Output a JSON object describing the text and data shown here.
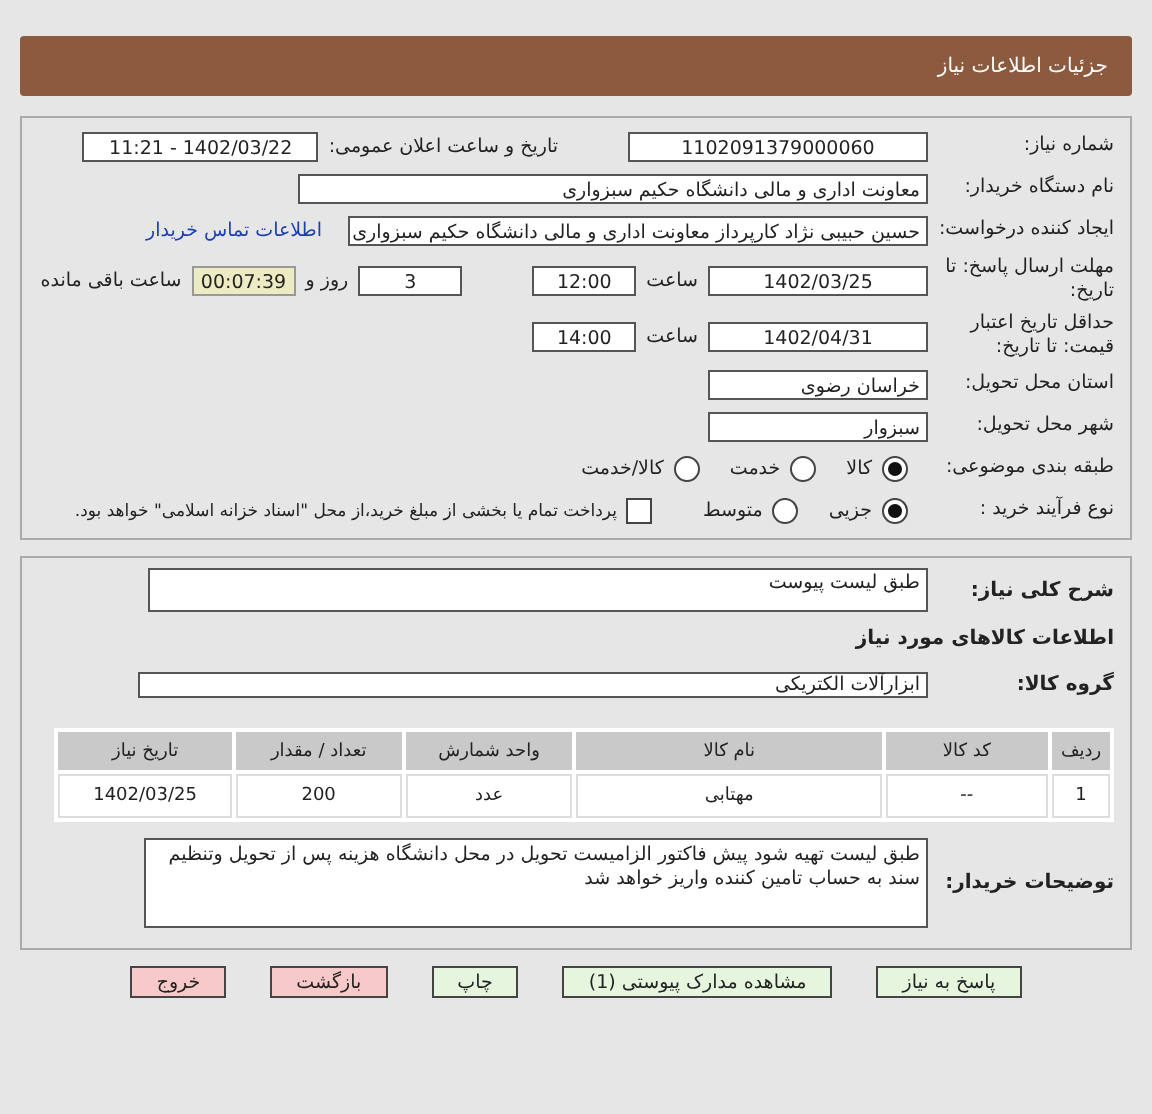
{
  "header": {
    "title": "جزئیات اطلاعات نیاز"
  },
  "details": {
    "need_number": {
      "label": "شماره نیاز:",
      "value": "1102091379000060"
    },
    "announce": {
      "label": "تاریخ و ساعت اعلان عمومی:",
      "value": "1402/03/22 - 11:21"
    },
    "buyer": {
      "label": "نام دستگاه خریدار:",
      "value": "معاونت اداری و مالی دانشگاه حکیم سبزواری"
    },
    "creator": {
      "label": "ایجاد کننده درخواست:",
      "value": "حسین حبیبی نژاد کارپرداز معاونت اداری و مالی دانشگاه حکیم سبزواری",
      "link": "اطلاعات تماس خریدار"
    },
    "deadline": {
      "label": "مهلت ارسال پاسخ: تا تاریخ:",
      "date": "1402/03/25",
      "time_label": "ساعت",
      "time": "12:00",
      "days": "3",
      "days_label": "روز و",
      "remaining": "00:07:39",
      "remaining_label": "ساعت باقی مانده"
    },
    "validity": {
      "label": "حداقل تاریخ اعتبار قیمت: تا تاریخ:",
      "date": "1402/04/31",
      "time_label": "ساعت",
      "time": "14:00"
    },
    "province": {
      "label": "استان محل تحویل:",
      "value": "خراسان رضوی"
    },
    "city": {
      "label": "شهر محل تحویل:",
      "value": "سبزوار"
    },
    "category": {
      "label": "طبقه بندی موضوعی:",
      "options": [
        {
          "label": "کالا",
          "selected": true
        },
        {
          "label": "خدمت",
          "selected": false
        },
        {
          "label": "کالا/خدمت",
          "selected": false
        }
      ]
    },
    "process": {
      "label": "نوع فرآیند خرید :",
      "options": [
        {
          "label": "جزیی",
          "selected": true
        },
        {
          "label": "متوسط",
          "selected": false
        }
      ],
      "treasury": {
        "label": "پرداخت تمام یا بخشی از مبلغ خرید،از محل \"اسناد خزانه اسلامی\" خواهد بود.",
        "checked": false
      }
    }
  },
  "need": {
    "summary": {
      "label": "شرح کلی نیاز:",
      "value": "طبق لیست پیوست"
    },
    "goods_heading": "اطلاعات کالاهای مورد نیاز",
    "group": {
      "label": "گروه کالا:",
      "value": "ابزارآلات الکتریکی"
    },
    "table": {
      "columns": [
        "ردیف",
        "کد کالا",
        "نام کالا",
        "واحد شمارش",
        "تعداد / مقدار",
        "تاریخ نیاز"
      ],
      "rows": [
        [
          "1",
          "--",
          "مهتابی",
          "عدد",
          "200",
          "1402/03/25"
        ]
      ]
    },
    "notes": {
      "label": "توضیحات خریدار:",
      "value": "طبق لیست تهیه شود پیش فاکتور الزامیست  تحویل در محل دانشگاه هزینه پس از تحویل وتنظیم سند به حساب تامین کننده واریز خواهد شد"
    }
  },
  "buttons": [
    {
      "label": "پاسخ به نیاز",
      "kind": "ok"
    },
    {
      "label": "مشاهده مدارک پیوستی (1)",
      "kind": "ok"
    },
    {
      "label": "چاپ",
      "kind": "ok"
    },
    {
      "label": "بازگشت",
      "kind": "danger"
    },
    {
      "label": "خروج",
      "kind": "danger"
    }
  ]
}
